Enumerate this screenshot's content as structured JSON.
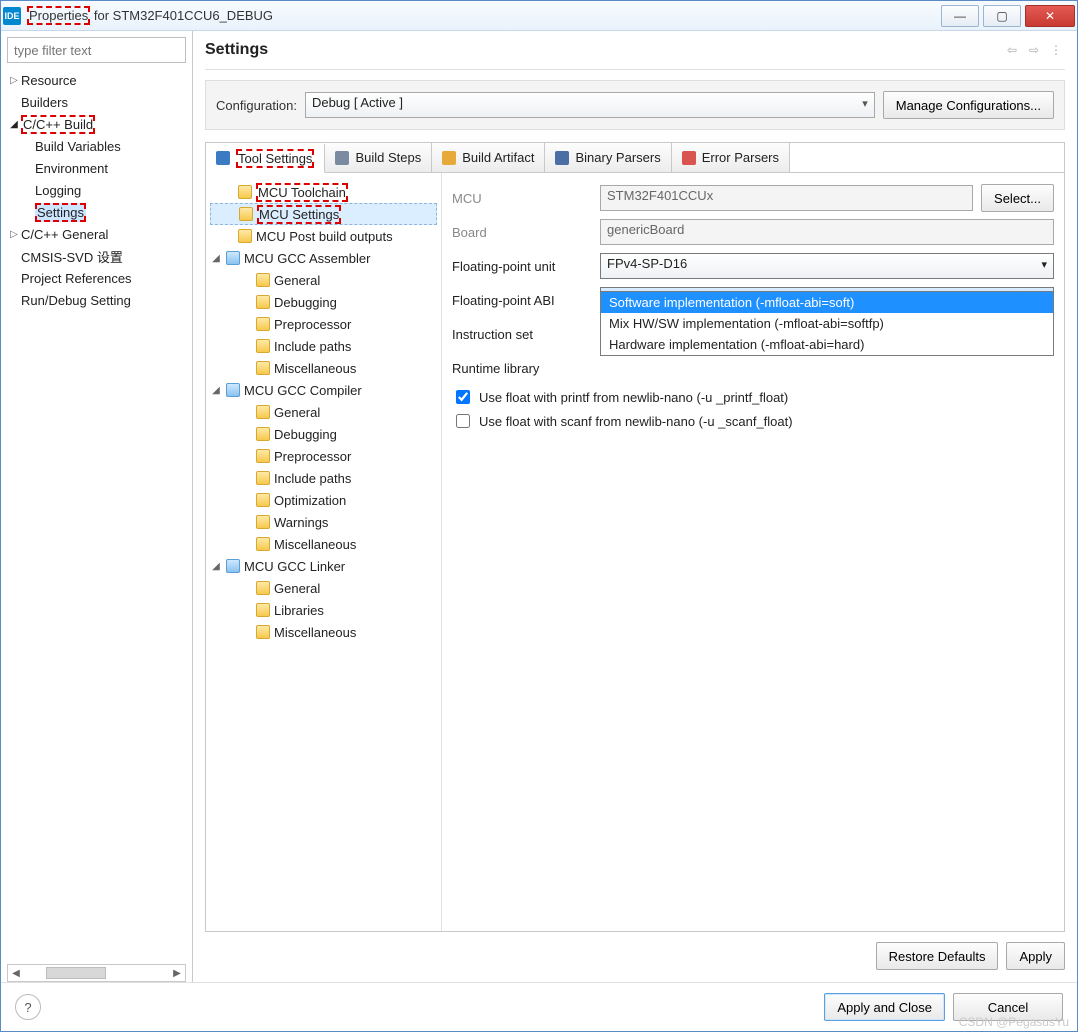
{
  "window": {
    "icon": "IDE",
    "title_prefix": "Properties",
    "title_rest": " for STM32F401CCU6_DEBUG"
  },
  "filter_placeholder": "type filter text",
  "nav": [
    {
      "label": "Resource",
      "depth": 0,
      "arrow": "▷"
    },
    {
      "label": "Builders",
      "depth": 0,
      "arrow": ""
    },
    {
      "label": "C/C++ Build",
      "depth": 0,
      "arrow": "◢",
      "hi": true,
      "open": true
    },
    {
      "label": "Build Variables",
      "depth": 1,
      "arrow": ""
    },
    {
      "label": "Environment",
      "depth": 1,
      "arrow": ""
    },
    {
      "label": "Logging",
      "depth": 1,
      "arrow": ""
    },
    {
      "label": "Settings",
      "depth": 1,
      "arrow": "",
      "hi": true,
      "sel": true
    },
    {
      "label": "C/C++ General",
      "depth": 0,
      "arrow": "▷"
    },
    {
      "label": "CMSIS-SVD 设置",
      "depth": 0,
      "arrow": ""
    },
    {
      "label": "Project References",
      "depth": 0,
      "arrow": ""
    },
    {
      "label": "Run/Debug Setting",
      "depth": 0,
      "arrow": ""
    }
  ],
  "page_title": "Settings",
  "config_label": "Configuration:",
  "config_value": "Debug  [ Active ]",
  "manage_btn": "Manage Configurations...",
  "tabs": [
    {
      "label": "Tool Settings",
      "active": true,
      "hi": true,
      "color": "#3b7bc4"
    },
    {
      "label": "Build Steps",
      "color": "#7a8aa0"
    },
    {
      "label": "Build Artifact",
      "color": "#e7a93a"
    },
    {
      "label": "Binary Parsers",
      "color": "#4a6fa5"
    },
    {
      "label": "Error Parsers",
      "color": "#d9534f"
    }
  ],
  "tree": [
    {
      "label": "MCU Toolchain",
      "depth": 1,
      "group": false,
      "hi": true
    },
    {
      "label": "MCU Settings",
      "depth": 1,
      "group": false,
      "hi": true,
      "sel": true
    },
    {
      "label": "MCU Post build outputs",
      "depth": 1,
      "group": false
    },
    {
      "label": "MCU GCC Assembler",
      "depth": 0,
      "group": true,
      "tw": "◢"
    },
    {
      "label": "General",
      "depth": 2
    },
    {
      "label": "Debugging",
      "depth": 2
    },
    {
      "label": "Preprocessor",
      "depth": 2
    },
    {
      "label": "Include paths",
      "depth": 2
    },
    {
      "label": "Miscellaneous",
      "depth": 2
    },
    {
      "label": "MCU GCC Compiler",
      "depth": 0,
      "group": true,
      "tw": "◢"
    },
    {
      "label": "General",
      "depth": 2
    },
    {
      "label": "Debugging",
      "depth": 2
    },
    {
      "label": "Preprocessor",
      "depth": 2
    },
    {
      "label": "Include paths",
      "depth": 2
    },
    {
      "label": "Optimization",
      "depth": 2
    },
    {
      "label": "Warnings",
      "depth": 2
    },
    {
      "label": "Miscellaneous",
      "depth": 2
    },
    {
      "label": "MCU GCC Linker",
      "depth": 0,
      "group": true,
      "tw": "◢"
    },
    {
      "label": "General",
      "depth": 2
    },
    {
      "label": "Libraries",
      "depth": 2
    },
    {
      "label": "Miscellaneous",
      "depth": 2
    }
  ],
  "form": {
    "mcu_label": "MCU",
    "mcu_value": "STM32F401CCUx",
    "select_btn": "Select...",
    "board_label": "Board",
    "board_value": "genericBoard",
    "fpu_label": "Floating-point unit",
    "fpu_value": "FPv4-SP-D16",
    "fpabi_label": "Floating-point ABI",
    "fpabi_value": "Software implementation (-mfloat-abi=soft)",
    "instr_label": "Instruction set",
    "rt_label": "Runtime library",
    "dropdown": [
      {
        "label": "Software implementation (-mfloat-abi=soft)",
        "sel": true
      },
      {
        "label": "Mix HW/SW implementation (-mfloat-abi=softfp)"
      },
      {
        "label": "Hardware implementation (-mfloat-abi=hard)"
      }
    ],
    "chk1": {
      "checked": true,
      "label": "Use float with printf from newlib-nano (-u _printf_float)"
    },
    "chk2": {
      "checked": false,
      "label": "Use float with scanf from newlib-nano (-u _scanf_float)"
    }
  },
  "restore_btn": "Restore Defaults",
  "apply_btn": "Apply",
  "apply_close_btn": "Apply and Close",
  "cancel_btn": "Cancel",
  "watermark": "CSDN @PegasusYu"
}
